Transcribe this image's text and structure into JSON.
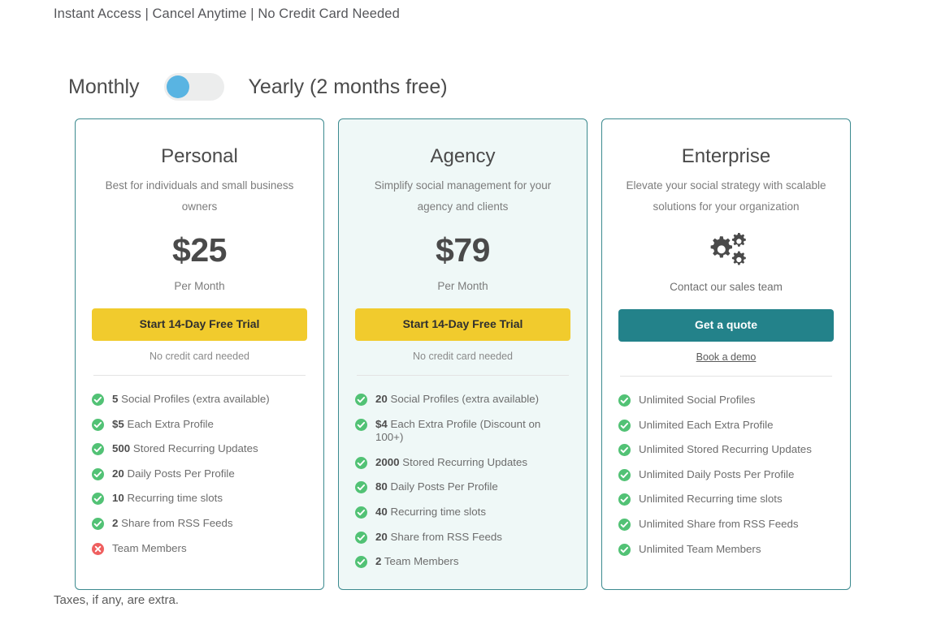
{
  "header": {
    "tagline": "Instant Access | Cancel Anytime | No Credit Card Needed"
  },
  "billing": {
    "monthly_label": "Monthly",
    "yearly_label": "Yearly (2 months free)",
    "selected": "Monthly",
    "toggle_knob_color": "#59b4e2",
    "toggle_track_color": "#eceded"
  },
  "colors": {
    "card_border": "#3c8a8f",
    "highlight_bg": "#eff8f7",
    "yellow_button": "#f1cb2d",
    "teal_button": "#23828a",
    "check_green": "#52c275",
    "cross_red": "#ef5f5f"
  },
  "plans": [
    {
      "name": "Personal",
      "description": "Best for individuals and small business owners",
      "price": "$25",
      "period": "Per Month",
      "cta_label": "Start 14-Day Free Trial",
      "cta_note": "No credit card needed",
      "features": [
        {
          "value": "5",
          "label": " Social Profiles (extra available)",
          "available": true
        },
        {
          "value": "$5",
          "label": " Each Extra Profile",
          "available": true
        },
        {
          "value": "500",
          "label": " Stored Recurring Updates",
          "available": true
        },
        {
          "value": "20",
          "label": " Daily Posts Per Profile",
          "available": true
        },
        {
          "value": "10",
          "label": " Recurring time slots",
          "available": true
        },
        {
          "value": "2",
          "label": " Share from RSS Feeds",
          "available": true
        },
        {
          "value": "",
          "label": "Team Members",
          "available": false
        }
      ]
    },
    {
      "name": "Agency",
      "description": "Simplify social management for your agency and clients",
      "price": "$79",
      "period": "Per Month",
      "cta_label": "Start 14-Day Free Trial",
      "cta_note": "No credit card needed",
      "features": [
        {
          "value": "20",
          "label": " Social Profiles (extra available)",
          "available": true
        },
        {
          "value": "$4",
          "label": " Each Extra Profile (Discount on 100+)",
          "available": true
        },
        {
          "value": "2000",
          "label": " Stored Recurring Updates",
          "available": true
        },
        {
          "value": "80",
          "label": " Daily Posts Per Profile",
          "available": true
        },
        {
          "value": "40",
          "label": " Recurring time slots",
          "available": true
        },
        {
          "value": "20",
          "label": " Share from RSS Feeds",
          "available": true
        },
        {
          "value": "2",
          "label": " Team Members",
          "available": true
        }
      ]
    },
    {
      "name": "Enterprise",
      "description": "Elevate your social strategy with scalable solutions for your organization",
      "icon": "gears-icon",
      "contact_line": "Contact our sales team",
      "cta_label": "Get a quote",
      "cta_note_link": "Book a demo",
      "features": [
        {
          "value": "",
          "label": "Unlimited Social Profiles",
          "available": true
        },
        {
          "value": "",
          "label": "Unlimited Each Extra Profile",
          "available": true
        },
        {
          "value": "",
          "label": "Unlimited Stored Recurring Updates",
          "available": true
        },
        {
          "value": "",
          "label": "Unlimited Daily Posts Per Profile",
          "available": true
        },
        {
          "value": "",
          "label": "Unlimited Recurring time slots",
          "available": true
        },
        {
          "value": "",
          "label": "Unlimited Share from RSS Feeds",
          "available": true
        },
        {
          "value": "",
          "label": "Unlimited Team Members",
          "available": true
        }
      ]
    }
  ],
  "footer": {
    "note": "Taxes, if any, are extra."
  }
}
